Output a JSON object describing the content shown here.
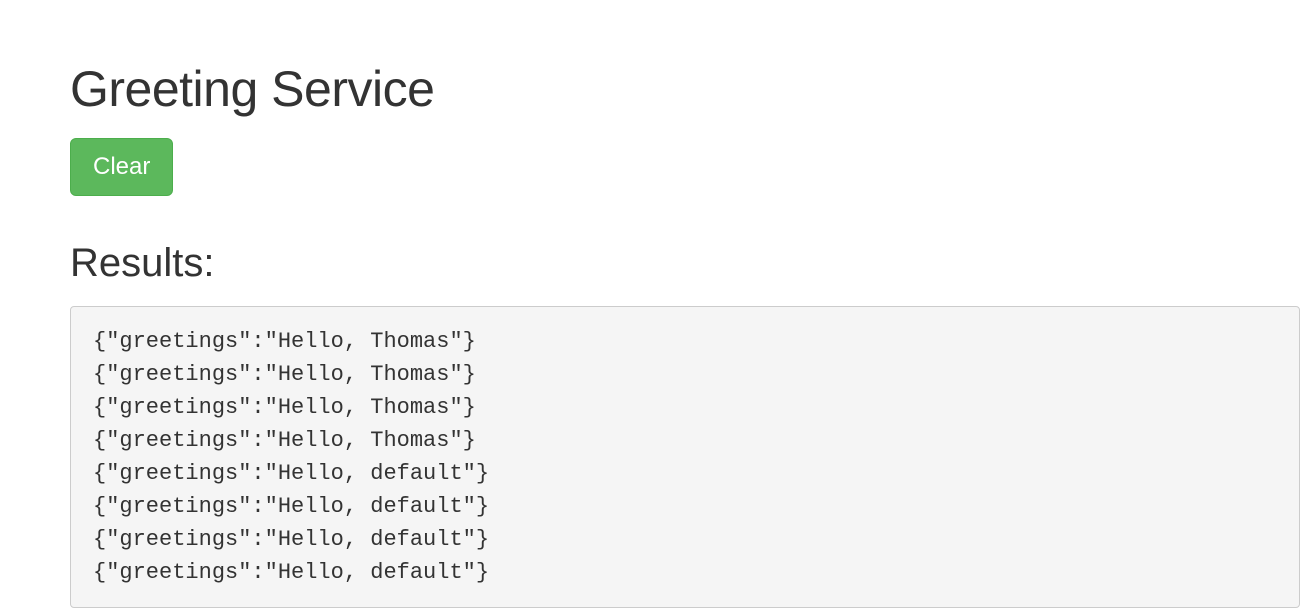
{
  "header": {
    "title": "Greeting Service"
  },
  "toolbar": {
    "clear_label": "Clear"
  },
  "results": {
    "heading": "Results:",
    "lines": [
      "{\"greetings\":\"Hello, Thomas\"}",
      "{\"greetings\":\"Hello, Thomas\"}",
      "{\"greetings\":\"Hello, Thomas\"}",
      "{\"greetings\":\"Hello, Thomas\"}",
      "{\"greetings\":\"Hello, default\"}",
      "{\"greetings\":\"Hello, default\"}",
      "{\"greetings\":\"Hello, default\"}",
      "{\"greetings\":\"Hello, default\"}"
    ]
  }
}
